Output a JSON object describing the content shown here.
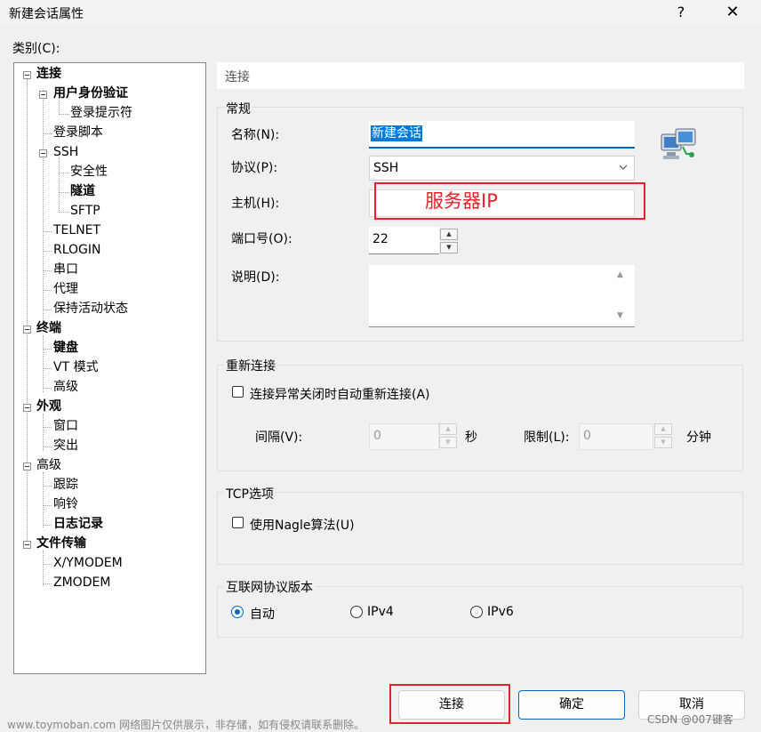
{
  "window": {
    "title": "新建会话属性",
    "help": "?",
    "close": "✕"
  },
  "tree": {
    "label": "类别(C):",
    "nodes": [
      {
        "id": "lianjie",
        "label": "连接",
        "bold": true
      },
      {
        "id": "yonghu",
        "label": "用户身份验证",
        "bold": true
      },
      {
        "id": "denglutishi",
        "label": "登录提示符",
        "bold": false
      },
      {
        "id": "denglujiaoben",
        "label": "登录脚本",
        "bold": false
      },
      {
        "id": "ssh",
        "label": "SSH",
        "bold": false
      },
      {
        "id": "anquanxing",
        "label": "安全性",
        "bold": false
      },
      {
        "id": "suidao",
        "label": "隧道",
        "bold": true
      },
      {
        "id": "sftp",
        "label": "SFTP",
        "bold": false
      },
      {
        "id": "telnet",
        "label": "TELNET",
        "bold": false
      },
      {
        "id": "rlogin",
        "label": "RLOGIN",
        "bold": false
      },
      {
        "id": "chuankou",
        "label": "串口",
        "bold": false
      },
      {
        "id": "daili",
        "label": "代理",
        "bold": false
      },
      {
        "id": "baochi",
        "label": "保持活动状态",
        "bold": false
      },
      {
        "id": "zhongduan",
        "label": "终端",
        "bold": true
      },
      {
        "id": "jianpan",
        "label": "键盘",
        "bold": true
      },
      {
        "id": "vt",
        "label": "VT 模式",
        "bold": false
      },
      {
        "id": "gaoji1",
        "label": "高级",
        "bold": false
      },
      {
        "id": "waiguan",
        "label": "外观",
        "bold": true
      },
      {
        "id": "chuangkou",
        "label": "窗口",
        "bold": false
      },
      {
        "id": "tuchu",
        "label": "突出",
        "bold": false
      },
      {
        "id": "gaoji2",
        "label": "高级",
        "bold": false
      },
      {
        "id": "genzong",
        "label": "跟踪",
        "bold": false
      },
      {
        "id": "xiangling",
        "label": "响铃",
        "bold": false
      },
      {
        "id": "rizhi",
        "label": "日志记录",
        "bold": true
      },
      {
        "id": "wenjian",
        "label": "文件传输",
        "bold": true
      },
      {
        "id": "xymodem",
        "label": "X/YMODEM",
        "bold": false
      },
      {
        "id": "zmodem",
        "label": "ZMODEM",
        "bold": false
      }
    ]
  },
  "panel": {
    "header": "连接",
    "general": {
      "title": "常规",
      "name_label": "名称(N):",
      "name_value": "新建会话",
      "protocol_label": "协议(P):",
      "protocol_value": "SSH",
      "host_label": "主机(H):",
      "host_annotation": "服务器IP",
      "port_label": "端口号(O):",
      "port_value": "22",
      "desc_label": "说明(D):"
    },
    "reconnect": {
      "title": "重新连接",
      "checkbox_label": "连接异常关闭时自动重新连接(A)",
      "interval_label": "间隔(V):",
      "interval_value": "0",
      "interval_unit": "秒",
      "limit_label": "限制(L):",
      "limit_value": "0",
      "limit_unit": "分钟"
    },
    "tcp": {
      "title": "TCP选项",
      "checkbox_label": "使用Nagle算法(U)"
    },
    "ip": {
      "title": "互联网协议版本",
      "options": [
        "自动",
        "IPv4",
        "IPv6"
      ],
      "selected": "自动"
    }
  },
  "buttons": {
    "connect": "连接",
    "ok": "确定",
    "cancel": "取消"
  },
  "footer": {
    "watermark": "www.toymoban.com 网络图片仅供展示，非存储，如有侵权请联系删除。",
    "csdn": "CSDN @007键客"
  },
  "colors": {
    "accent": "#0067c0",
    "annotation_red": "#e8202a",
    "selection": "#0078d7"
  }
}
